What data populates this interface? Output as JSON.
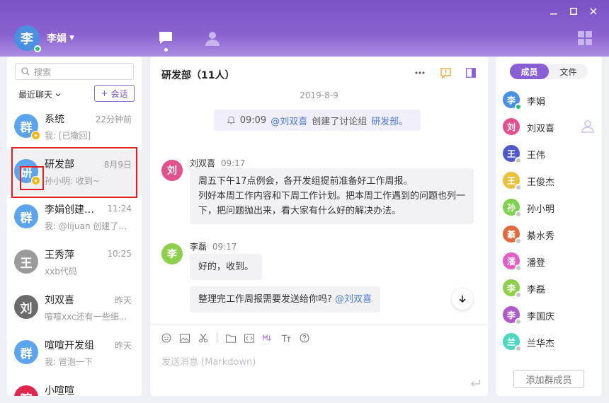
{
  "user": {
    "avatar_text": "李",
    "name": "李娟"
  },
  "colors": {
    "accent": "#8a5fd6",
    "online": "#21c46b",
    "badge": "#f5b50f",
    "mention": "#4a7bd6"
  },
  "sidebar": {
    "search_placeholder": "搜索",
    "recent_label": "最近聊天",
    "new_session_label": "会话",
    "conversations": [
      {
        "avatar": "群",
        "name": "系统",
        "time": "22分钟前",
        "preview": "我: [已撤回]",
        "color": "#5da4ee",
        "star": true
      },
      {
        "avatar": "研",
        "name": "研发部",
        "time": "8月9日",
        "preview": "孙小明: 收到~",
        "color": "#5da4ee",
        "star": true
      },
      {
        "avatar": "群",
        "name": "李娟创建的...",
        "time": "11:24",
        "preview": "我: @lijuan 创建了讨...",
        "color": "#5da4ee",
        "star": false
      },
      {
        "avatar": "王",
        "name": "王秀萍",
        "time": "10:25",
        "preview": "xxb代码",
        "color": "#9b9b9b",
        "star": false
      },
      {
        "avatar": "刘",
        "name": "刘双喜",
        "time": "昨天",
        "preview": "喧喧xxc还有一些细...",
        "color": "#6b6b6b",
        "star": false
      },
      {
        "avatar": "群",
        "name": "喧喧开发组",
        "time": "昨天",
        "preview": "我: 冒泡一下",
        "color": "#5da4ee",
        "star": false
      },
      {
        "avatar": "喧",
        "name": "小喧喧",
        "time": "",
        "preview": "",
        "color": "#e0284f",
        "star": false
      }
    ]
  },
  "chat": {
    "title": "研发部（11人）",
    "date": "2019-8-9",
    "notice": {
      "time": "09:09",
      "mention": "@刘双喜",
      "text": "创建了讨论组",
      "group": "研发部。"
    },
    "messages": [
      {
        "avatar": "刘",
        "color": "#e2508e",
        "sender": "刘双喜",
        "time": "09:17",
        "lines": [
          "周五下午17点例会，各开发组提前准备好工作周报。",
          "列好本周工作内容和下周工作计划。把本周工作遇到的问题也列一",
          "下，把问题抛出来，看大家有什么好的解决办法。"
        ]
      },
      {
        "avatar": "李",
        "color": "#8ed04a",
        "sender": "李磊",
        "time": "09:17",
        "lines": [
          "好的，收到。"
        ],
        "extra": {
          "text": "整理完工作周报需要发送给你吗?",
          "mention": "@刘双喜"
        }
      }
    ],
    "composer_placeholder": "发送消息 (Markdown)"
  },
  "members": {
    "tabs": [
      "成员",
      "文件"
    ],
    "list": [
      {
        "avatar": "李",
        "name": "李娟",
        "color": "#4a90e2",
        "status": "#21c46b"
      },
      {
        "avatar": "刘",
        "name": "刘双喜",
        "color": "#e2508e",
        "status": "",
        "person_icon": true
      },
      {
        "avatar": "王",
        "name": "王伟",
        "color": "#4f5ac8",
        "status": "#c6c6c6"
      },
      {
        "avatar": "王",
        "name": "王俊杰",
        "color": "#e8c23a",
        "status": "#c6c6c6"
      },
      {
        "avatar": "孙",
        "name": "孙小明",
        "color": "#7ed24e",
        "status": "#c6c6c6"
      },
      {
        "avatar": "綦",
        "name": "綦水秀",
        "color": "#e06a3b",
        "status": "#c6c6c6"
      },
      {
        "avatar": "潘",
        "name": "潘登",
        "color": "#e45ec8",
        "status": "#c6c6c6"
      },
      {
        "avatar": "李",
        "name": "李磊",
        "color": "#8ed04a",
        "status": "#c6c6c6"
      },
      {
        "avatar": "李",
        "name": "李国庆",
        "color": "#b05ac8",
        "status": "#c6c6c6"
      },
      {
        "avatar": "兰",
        "name": "兰华杰",
        "color": "#4ed8c0",
        "status": "#c6c6c6"
      }
    ],
    "add_label": "添加群成员"
  }
}
